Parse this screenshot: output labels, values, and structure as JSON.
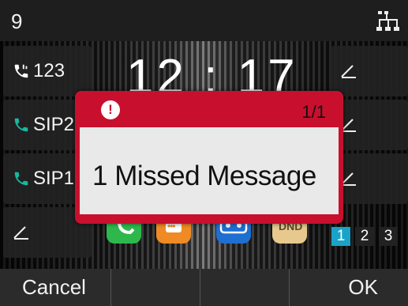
{
  "status": {
    "account_number": "9",
    "network_icon": "network-status-icon"
  },
  "clock": "12 : 17",
  "line_keys": [
    {
      "label": "123",
      "icon": "phone-icon",
      "color": "#ffffff"
    },
    {
      "label": "SIP2",
      "icon": "phone-icon",
      "color": "#19b8a0"
    },
    {
      "label": "SIP1",
      "icon": "phone-icon",
      "color": "#19b8a0"
    },
    {
      "label": "",
      "icon": "pen-icon"
    }
  ],
  "right_keys": [
    {
      "icon": "pen-icon"
    },
    {
      "icon": "pen-icon"
    },
    {
      "icon": "pen-icon"
    }
  ],
  "apps": [
    {
      "name": "phone-app",
      "color": "#2eb84b"
    },
    {
      "name": "message-app",
      "color": "#f08a24",
      "label": "•••"
    },
    {
      "name": "voicemail-app",
      "color": "#1e6fd0"
    },
    {
      "name": "dnd-app",
      "color": "#e7c98d",
      "label": "DND"
    }
  ],
  "pages": [
    "1",
    "2",
    "3"
  ],
  "active_page": "1",
  "dialog": {
    "counter": "1/1",
    "message": "1 Missed Message",
    "accent": "#c8102e",
    "icon": "alert-icon"
  },
  "softkeys": {
    "left": "Cancel",
    "k2": "",
    "k3": "",
    "right": "OK"
  }
}
